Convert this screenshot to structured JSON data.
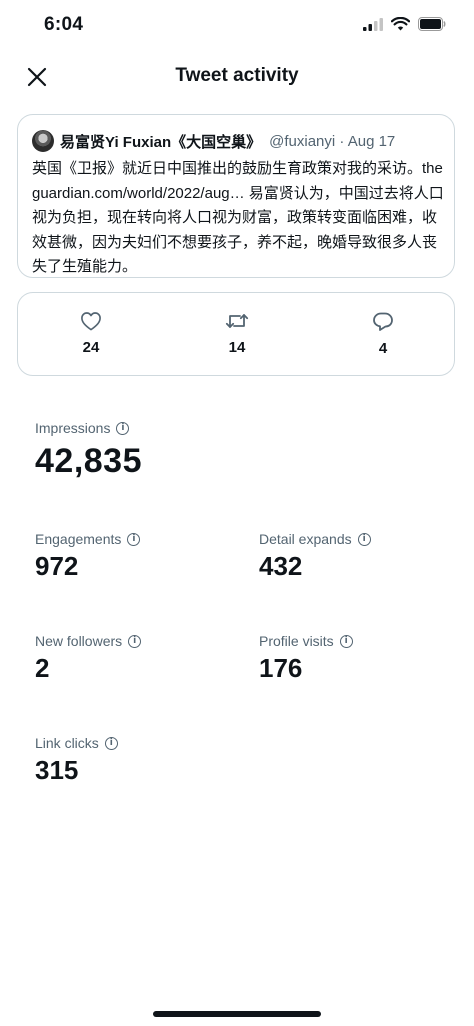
{
  "status_bar": {
    "time": "6:04"
  },
  "header": {
    "title": "Tweet activity"
  },
  "tweet": {
    "author_name": "易富贤Yi Fuxian《大国空巢》",
    "handle": "@fuxianyi",
    "separator": "·",
    "date": "Aug 17",
    "text": "英国《卫报》就近日中国推出的鼓励生育政策对我的采访。theguardian.com/world/2022/aug… 易富贤认为，中国过去将人口视为负担，现在转向将人口视为财富，政策转变面临困难，收效甚微，因为夫妇们不想要孩子，养不起，晚婚导致很多人丧失了生殖能力。"
  },
  "metrics": {
    "likes": "24",
    "retweets": "14",
    "replies": "4"
  },
  "stats": {
    "impressions": {
      "label": "Impressions",
      "value": "42,835"
    },
    "engagements": {
      "label": "Engagements",
      "value": "972"
    },
    "detail_expands": {
      "label": "Detail expands",
      "value": "432"
    },
    "new_followers": {
      "label": "New followers",
      "value": "2"
    },
    "profile_visits": {
      "label": "Profile visits",
      "value": "176"
    },
    "link_clicks": {
      "label": "Link clicks",
      "value": "315"
    }
  },
  "icons": {
    "info": "i",
    "close": "close-icon",
    "like": "heart-icon",
    "retweet": "retweet-icon",
    "reply": "reply-icon"
  },
  "colors": {
    "text": "#0f1419",
    "secondary": "#536471",
    "border": "#cfd9de"
  }
}
